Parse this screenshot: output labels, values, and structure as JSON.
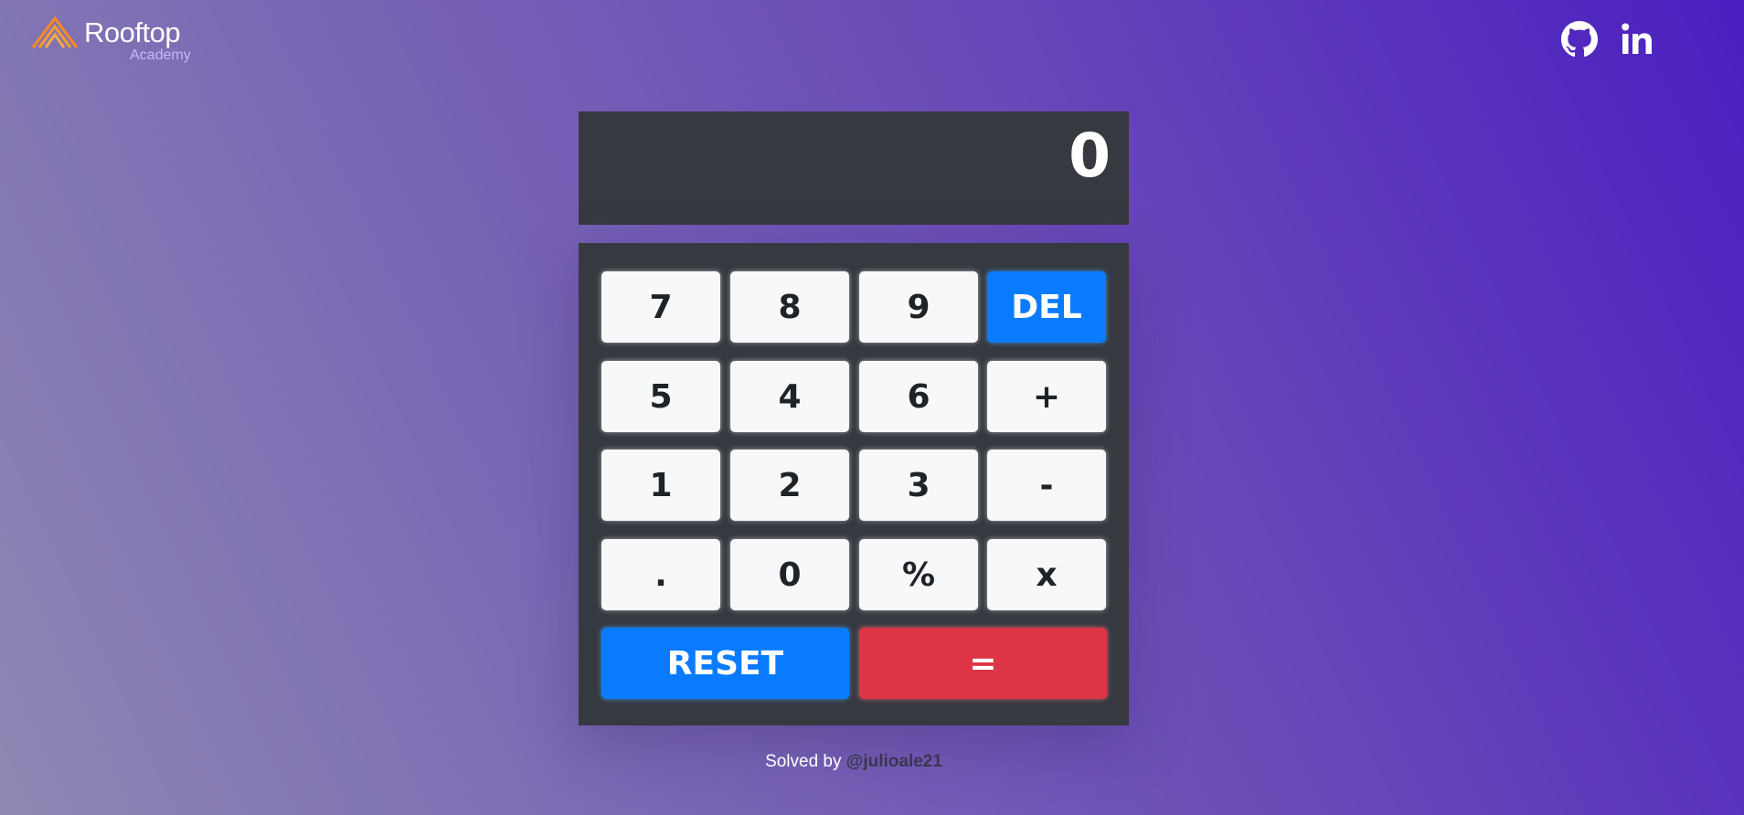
{
  "brand": {
    "name": "Rooftop",
    "sub": "Academy",
    "colors": {
      "orange": "#f4892b",
      "sub": "#c8b6ff"
    }
  },
  "social": [
    {
      "icon": "github-icon"
    },
    {
      "icon": "linkedin-icon",
      "label": "in"
    }
  ],
  "display": {
    "value": "0"
  },
  "keys": {
    "seven": "7",
    "eight": "8",
    "nine": "9",
    "del": "DEL",
    "five": "5",
    "four": "4",
    "six": "6",
    "plus": "+",
    "one": "1",
    "two": "2",
    "three": "3",
    "minus": "-",
    "dot": ".",
    "zero": "0",
    "percent": "%",
    "times": "x",
    "reset": "RESET",
    "equals": "="
  },
  "footer": {
    "prefix": "Solved by ",
    "handle": "@julioale21"
  },
  "colors": {
    "panel": "#363a40",
    "key": "#f7f8fa",
    "blue": "#0a7bff",
    "red": "#dc3545"
  }
}
